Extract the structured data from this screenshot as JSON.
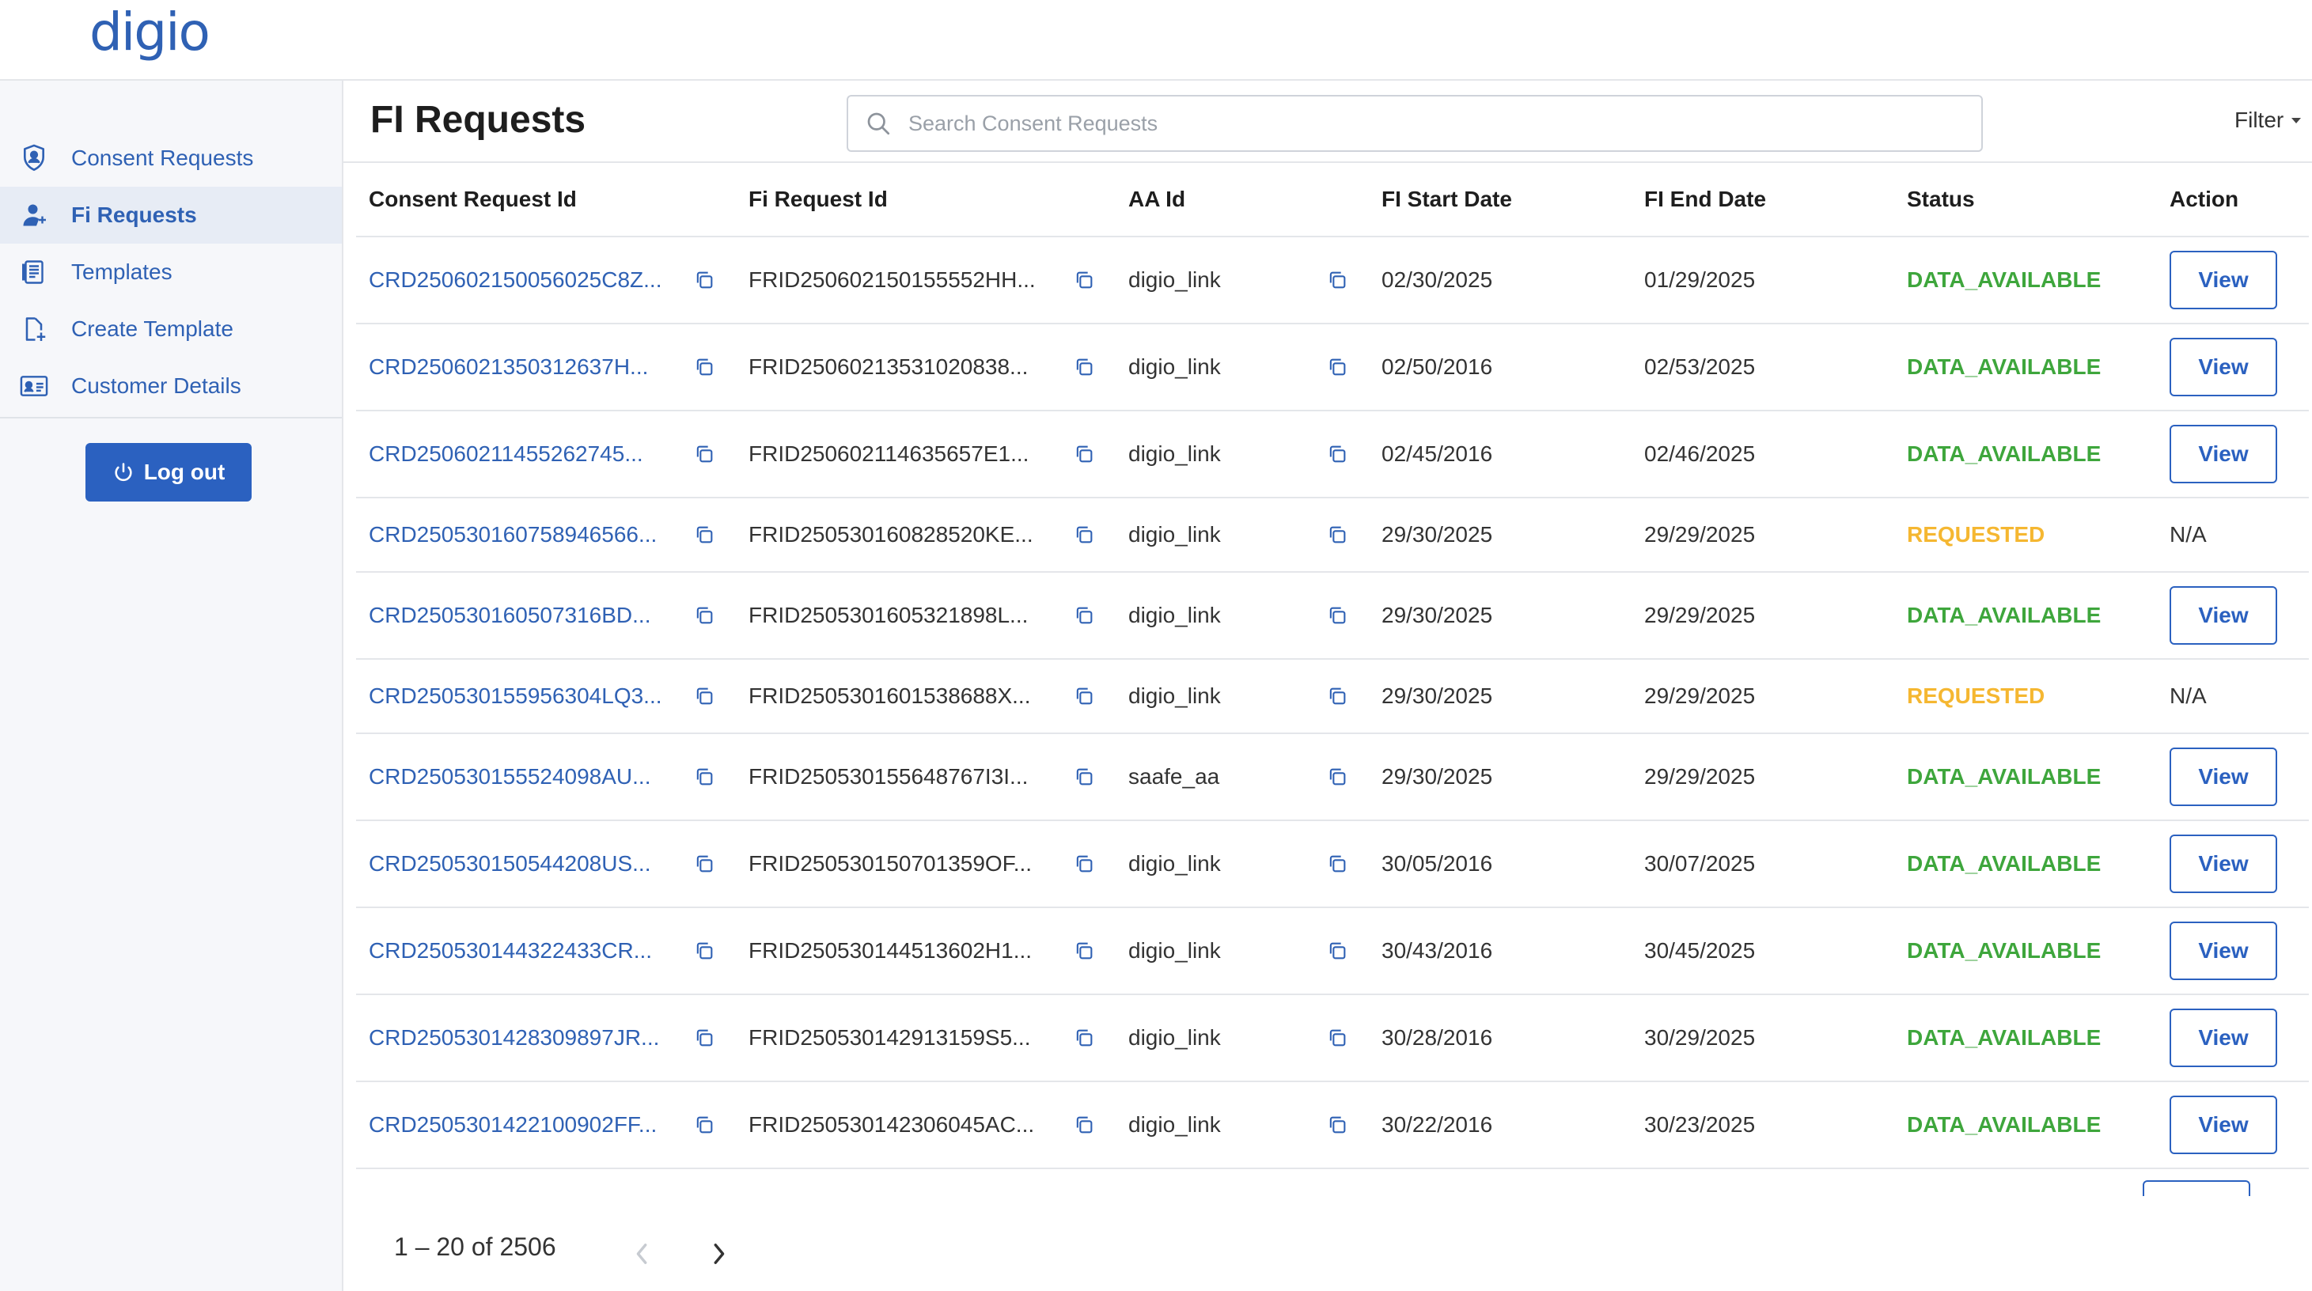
{
  "app": {
    "logo": "digio"
  },
  "sidebar": {
    "items": [
      {
        "label": "Consent Requests",
        "icon": "shield-user-icon",
        "active": false
      },
      {
        "label": "Fi Requests",
        "icon": "user-icon",
        "active": true
      },
      {
        "label": "Templates",
        "icon": "document-icon",
        "active": false
      },
      {
        "label": "Create Template",
        "icon": "file-add-icon",
        "active": false
      },
      {
        "label": "Customer Details",
        "icon": "id-card-icon",
        "active": false
      }
    ],
    "logout_label": "Log out"
  },
  "header": {
    "title": "FI Requests",
    "search_placeholder": "Search Consent Requests",
    "filter_label": "Filter"
  },
  "table": {
    "columns": [
      "Consent Request Id",
      "Fi Request Id",
      "AA Id",
      "FI Start Date",
      "FI End Date",
      "Status",
      "Action"
    ],
    "rows": [
      {
        "consent_id": "CRD250602150056025C8Z...",
        "fi_id": "FRID250602150155552HH...",
        "aa_id": "digio_link",
        "start": "02/30/2025",
        "end": "01/29/2025",
        "status": "DATA_AVAILABLE",
        "action": "View"
      },
      {
        "consent_id": "CRD2506021350312637H...",
        "fi_id": "FRID25060213531020838...",
        "aa_id": "digio_link",
        "start": "02/50/2016",
        "end": "02/53/2025",
        "status": "DATA_AVAILABLE",
        "action": "View"
      },
      {
        "consent_id": "CRD25060211455262745...",
        "fi_id": "FRID250602114635657E1...",
        "aa_id": "digio_link",
        "start": "02/45/2016",
        "end": "02/46/2025",
        "status": "DATA_AVAILABLE",
        "action": "View"
      },
      {
        "consent_id": "CRD250530160758946566...",
        "fi_id": "FRID250530160828520KE...",
        "aa_id": "digio_link",
        "start": "29/30/2025",
        "end": "29/29/2025",
        "status": "REQUESTED",
        "action": "N/A"
      },
      {
        "consent_id": "CRD250530160507316BD...",
        "fi_id": "FRID2505301605321898L...",
        "aa_id": "digio_link",
        "start": "29/30/2025",
        "end": "29/29/2025",
        "status": "DATA_AVAILABLE",
        "action": "View"
      },
      {
        "consent_id": "CRD250530155956304LQ3...",
        "fi_id": "FRID250530160153868​8X...",
        "aa_id": "digio_link",
        "start": "29/30/2025",
        "end": "29/29/2025",
        "status": "REQUESTED",
        "action": "N/A"
      },
      {
        "consent_id": "CRD250530155524098AU...",
        "fi_id": "FRID250530155648767I3I...",
        "aa_id": "saafe_aa",
        "start": "29/30/2025",
        "end": "29/29/2025",
        "status": "DATA_AVAILABLE",
        "action": "View"
      },
      {
        "consent_id": "CRD250530150544208US...",
        "fi_id": "FRID250530150701359OF...",
        "aa_id": "digio_link",
        "start": "30/05/2016",
        "end": "30/07/2025",
        "status": "DATA_AVAILABLE",
        "action": "View"
      },
      {
        "consent_id": "CRD250530144322433CR...",
        "fi_id": "FRID250530144513602H1...",
        "aa_id": "digio_link",
        "start": "30/43/2016",
        "end": "30/45/2025",
        "status": "DATA_AVAILABLE",
        "action": "View"
      },
      {
        "consent_id": "CRD2505301428309897JR...",
        "fi_id": "FRID250530142913159S5...",
        "aa_id": "digio_link",
        "start": "30/28/2016",
        "end": "30/29/2025",
        "status": "DATA_AVAILABLE",
        "action": "View"
      },
      {
        "consent_id": "CRD2505301422100902FF...",
        "fi_id": "FRID250530142306045AC...",
        "aa_id": "digio_link",
        "start": "30/22/2016",
        "end": "30/23/2025",
        "status": "DATA_AVAILABLE",
        "action": "View"
      }
    ]
  },
  "pagination": {
    "range_label": "1 – 20 of 2506"
  },
  "colors": {
    "brand": "#2b61c0",
    "link": "#2f61b4",
    "data_available": "#3ea63c",
    "requested": "#f5b731"
  }
}
